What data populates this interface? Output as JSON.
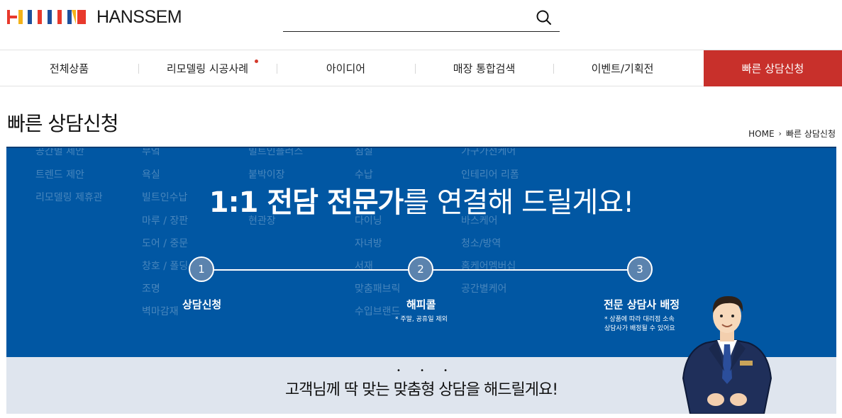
{
  "brand": {
    "name": "HANSSEM",
    "colors": [
      "#e8392c",
      "#f3b21a",
      "#1d4f9c",
      "#e8392c",
      "#1d4f9c",
      "#e8392c",
      "#f3b21a"
    ]
  },
  "search": {
    "value": "",
    "placeholder": "",
    "icon": "search-icon"
  },
  "nav": {
    "items": [
      {
        "label": "전체상품"
      },
      {
        "label": "리모델링 시공사례"
      },
      {
        "label": "아이디어"
      },
      {
        "label": "매장 통합검색"
      },
      {
        "label": "이벤트/기획전"
      },
      {
        "label": "빠른 상담신청"
      }
    ],
    "active_color": "#c8302b"
  },
  "page": {
    "title": "빠른 상담신청",
    "breadcrumb": [
      "HOME",
      "빠른 상담신청"
    ]
  },
  "banner": {
    "background": "#0157a3",
    "headline_bold": "1:1 전담 전문가",
    "headline_rest": "를 연결해 드릴게요!",
    "ghost_menu": [
      "공간별 제안",
      "트렌드 제안",
      "리모델링 제휴관",
      "부엌",
      "욕실",
      "빌트인수납",
      "마루 / 장판",
      "도어 / 중문",
      "창호 / 폴딩",
      "조명",
      "벽마감재",
      "빌트인플러스",
      "붙박이장",
      "현관장",
      "침실",
      "수납",
      "다이닝",
      "자녀방",
      "서재",
      "맞춤패브릭",
      "수입브랜드",
      "가구가전케어",
      "인테리어 리폼",
      "바스케어",
      "청소/방역",
      "홈케어멤버십",
      "공간별케어"
    ],
    "steps": [
      {
        "number": "1",
        "label": "상담신청",
        "note": ""
      },
      {
        "number": "2",
        "label": "해피콜",
        "note": "* 주말, 공휴일 제외"
      },
      {
        "number": "3",
        "label": "전문 상담사 배정",
        "note": "* 상품에 따라 대리점 소속\n상담사가 배정될 수 있어요"
      }
    ]
  },
  "strip": {
    "text": "고객님께 딱 맞는 맞춤형 상담을 해드릴게요!",
    "dots": "• • •"
  }
}
